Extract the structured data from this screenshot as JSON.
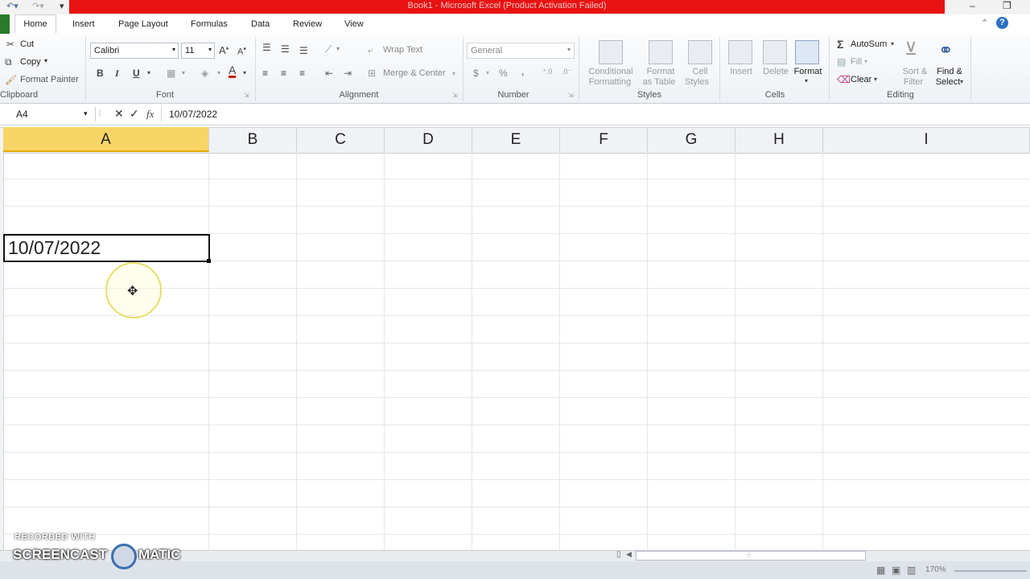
{
  "title_bar": {
    "title": "Book1 - Microsoft Excel (Product Activation Failed)"
  },
  "tabs": [
    {
      "label": "Home"
    },
    {
      "label": "Insert"
    },
    {
      "label": "Page Layout"
    },
    {
      "label": "Formulas"
    },
    {
      "label": "Data"
    },
    {
      "label": "Review"
    },
    {
      "label": "View"
    }
  ],
  "clipboard": {
    "cut": "Cut",
    "copy": "Copy",
    "format_painter": "Format Painter",
    "group": "Clipboard"
  },
  "font": {
    "name": "Calibri",
    "size": "11",
    "bold": "B",
    "italic": "I",
    "underline": "U",
    "color_letter": "A",
    "group": "Font"
  },
  "alignment": {
    "wrap_text": "Wrap Text",
    "merge_center": "Merge & Center",
    "group": "Alignment"
  },
  "number": {
    "format": "General",
    "currency": "$",
    "percent": "%",
    "comma": ",",
    "group": "Number"
  },
  "styles": {
    "conditional_1": "Conditional",
    "conditional_2": "Formatting",
    "format_table_1": "Format",
    "format_table_2": "as Table",
    "cell_styles_1": "Cell",
    "cell_styles_2": "Styles",
    "group": "Styles"
  },
  "cells": {
    "insert": "Insert",
    "delete": "Delete",
    "format": "Format",
    "group": "Cells"
  },
  "editing": {
    "autosum": "AutoSum",
    "fill": "Fill",
    "clear": "Clear",
    "sort_1": "Sort &",
    "sort_2": "Filter",
    "find_1": "Find &",
    "find_2": "Select",
    "group": "Editing"
  },
  "formula_bar": {
    "name_box": "A4",
    "fx": "fx",
    "value": "10/07/2022"
  },
  "columns": [
    "A",
    "B",
    "C",
    "D",
    "E",
    "F",
    "G",
    "H",
    "I"
  ],
  "active_cell": {
    "ref": "A4",
    "value": "10/07/2022"
  },
  "watermark": {
    "line1": "RECORDED WITH",
    "line2": "SCREENCAST",
    "line3": "MATIC"
  },
  "status": {
    "zoom": "170%"
  }
}
